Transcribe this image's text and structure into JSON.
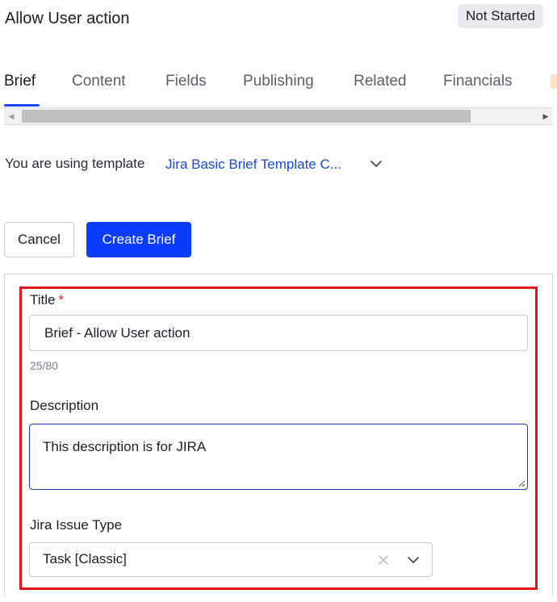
{
  "header": {
    "title": "Allow User action",
    "status": "Not Started"
  },
  "tabs": [
    {
      "label": "Brief",
      "active": true
    },
    {
      "label": "Content"
    },
    {
      "label": "Fields"
    },
    {
      "label": "Publishing"
    },
    {
      "label": "Related"
    },
    {
      "label": "Financials"
    }
  ],
  "template": {
    "label": "You are using template",
    "selected": "Jira Basic Brief Template C..."
  },
  "actions": {
    "cancel": "Cancel",
    "create": "Create Brief"
  },
  "form": {
    "title_label": "Title",
    "required_marker": "*",
    "title_value": "Brief - Allow User action",
    "title_count": "25/80",
    "description_label": "Description",
    "description_value": "This description is for JIRA",
    "issue_type_label": "Jira Issue Type",
    "issue_type_value": "Task [Classic]"
  },
  "colors": {
    "accent": "#0a3cff",
    "link": "#1a47d9",
    "highlight": "#e4141c",
    "required": "#e0272e"
  },
  "icons": [
    "chevron-down-icon",
    "close-icon",
    "scroll-left-icon",
    "scroll-right-icon",
    "resize-grip-icon"
  ]
}
